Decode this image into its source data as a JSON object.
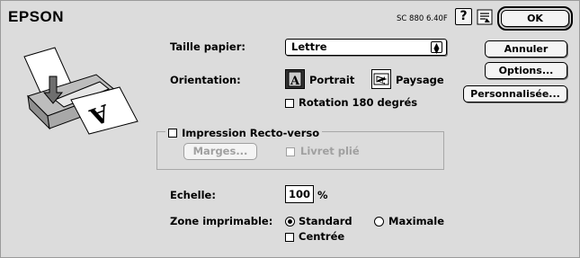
{
  "header": {
    "brand": "EPSON",
    "version": "SC 880 6.40F"
  },
  "buttons": {
    "ok": "OK",
    "cancel": "Annuler",
    "options": "Options...",
    "custom": "Personnalisée..."
  },
  "paper": {
    "label": "Taille papier:",
    "value": "Lettre"
  },
  "orientation": {
    "label": "Orientation:",
    "portrait": "Portrait",
    "landscape": "Paysage",
    "selected": "portrait",
    "rotate": "Rotation 180 degrés"
  },
  "duplex": {
    "label": "Impression Recto-verso",
    "margins": "Marges...",
    "booklet": "Livret plié"
  },
  "scale": {
    "label": "Echelle:",
    "value": "100",
    "unit": "%"
  },
  "printable": {
    "label": "Zone imprimable:",
    "standard": "Standard",
    "maximal": "Maximale",
    "centered": "Centrée",
    "selected": "standard"
  },
  "colors": {
    "background": "#dcdcdc",
    "button": "#f4f4f4",
    "disabled": "#a0a0a0"
  }
}
